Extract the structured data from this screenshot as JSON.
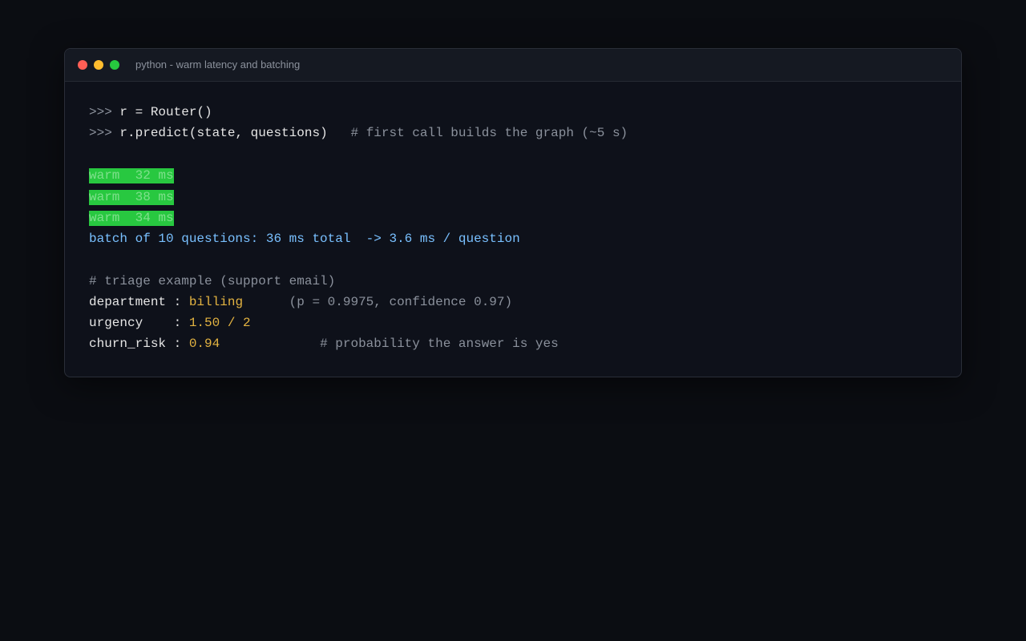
{
  "window": {
    "title": "python - warm latency and batching",
    "controls": [
      "close",
      "minimize",
      "maximize"
    ],
    "colors": {
      "close": "#ff5f56",
      "minimize": "#ffbd2e",
      "maximize": "#27c93f"
    }
  },
  "session": {
    "prompt": ">>>",
    "line1": "r = Router()",
    "line2": "r.predict(state, questions)",
    "line2_comment": "# first call builds the graph (~5 s)",
    "warm_runs": [
      "warm  32 ms",
      "warm  38 ms",
      "warm  34 ms"
    ],
    "batch_summary": "batch of 10 questions: 36 ms total  -> 3.6 ms / question"
  },
  "triage": {
    "comment": "# triage example (support email)",
    "department_key": "department : ",
    "department_value": "billing",
    "department_detail": "(p = 0.9975, confidence 0.97)",
    "urgency_key": "urgency    : ",
    "urgency_value": "1.50 / 2",
    "churn_key": "churn_risk : ",
    "churn_value": "0.94",
    "churn_comment": "# probability the answer is yes"
  },
  "colors": {
    "warm_highlight": "#28c840",
    "batch_text": "#79c0ff",
    "value_text": "#e3b341"
  }
}
